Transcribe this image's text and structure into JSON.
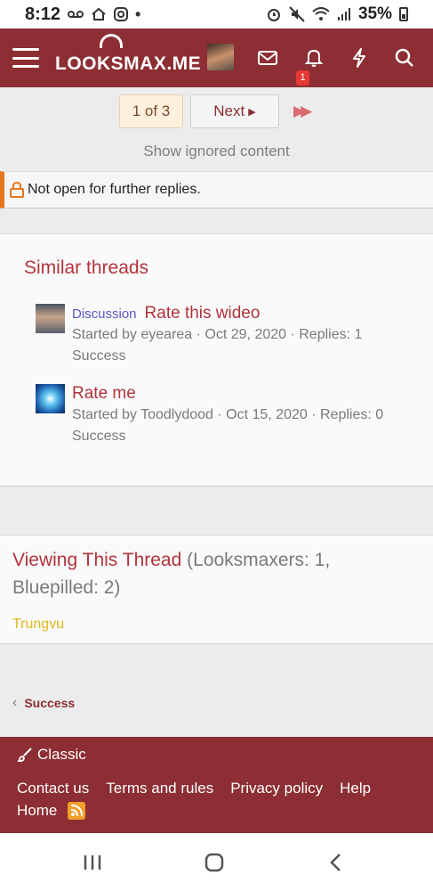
{
  "status_bar": {
    "time": "8:12",
    "battery": "35%",
    "left_icons": [
      "voicemail-icon",
      "home-icon",
      "instagram-icon",
      "dot-icon"
    ],
    "right_icons": [
      "alarm-icon",
      "mute-icon",
      "wifi-icon",
      "signal-icon",
      "battery-icon"
    ]
  },
  "header": {
    "logo_text": "LOOKSMAX.ME",
    "notification_count": "1"
  },
  "pagination": {
    "current": "1 of 3",
    "next_label": "Next"
  },
  "show_ignored": "Show ignored content",
  "notice": "Not open for further replies.",
  "similar_threads": {
    "title": "Similar threads",
    "items": [
      {
        "prefix": "Discussion",
        "title": "Rate this wideo",
        "meta": "Started by eyearea · Oct 29, 2020 · Replies: 1",
        "forum": "Success"
      },
      {
        "prefix": "",
        "title": "Rate me",
        "meta": "Started by Toodlydood · Oct 15, 2020 · Replies: 0",
        "forum": "Success"
      }
    ]
  },
  "viewing": {
    "title": "Viewing This Thread",
    "counts": "(Looksmaxers: 1, Bluepilled: 2)",
    "users": [
      "Trungvu"
    ]
  },
  "breadcrumb": {
    "label": "Success"
  },
  "footer": {
    "style": "Classic",
    "links": [
      "Contact us",
      "Terms and rules",
      "Privacy policy",
      "Help"
    ],
    "links2": [
      "Home"
    ]
  },
  "colors": {
    "brand": "#8c2e33",
    "link": "#b0343c",
    "prefix": "#5a55c7",
    "notice_accent": "#e7761f",
    "viewer": "#e0b81c"
  }
}
